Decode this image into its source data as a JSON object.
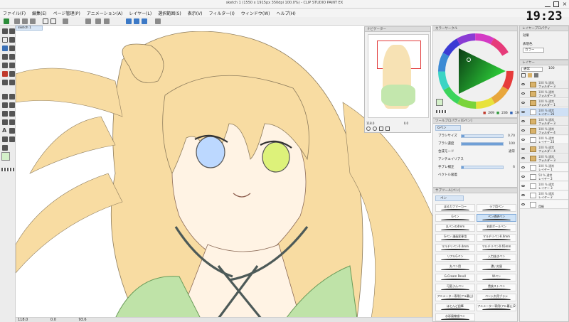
{
  "window": {
    "title": "sketch 1 (1550 x 1915px 350dpi 100.0%) - CLIP STUDIO PAINT EX"
  },
  "menu": {
    "items": [
      "ファイル(F)",
      "編集(E)",
      "ページ管理(P)",
      "アニメーション(A)",
      "レイヤー(L)",
      "選択範囲(S)",
      "表示(V)",
      "フィルター(I)",
      "ウィンドウ(W)",
      "ヘルプ(H)"
    ]
  },
  "clock": "19:23",
  "canvas": {
    "tab_label": "sketch 1"
  },
  "status": {
    "zoom": "118.0",
    "angle": "0.0",
    "label": "93.6"
  },
  "navigator": {
    "title": "ナビゲーター",
    "zoom": "118.0",
    "angle": "0.0"
  },
  "color_wheel": {
    "title": "カラーサークル",
    "h": "269",
    "s": "236",
    "v": "190",
    "colors": {
      "main": "#d4f0c9",
      "sub": "#ffffff"
    }
  },
  "tool_property": {
    "title": "ツールプロパティ[Gペン]",
    "tool_name": "Gペン",
    "rows": [
      {
        "label": "ブラシサイズ",
        "value": "0.70",
        "level": 0.07
      },
      {
        "label": "ブラシ濃度",
        "value": "100",
        "level": 1.0
      },
      {
        "label": "合成モード",
        "value": "通常"
      },
      {
        "label": "アンチエイリアス",
        "value": ""
      },
      {
        "label": "手ブレ補正",
        "value": "6",
        "level": 0.06
      },
      {
        "label": "ベクトル吸着",
        "value": ""
      }
    ]
  },
  "subtool": {
    "title": "サブツール[ペン]",
    "tab": "ペン",
    "brushes": [
      "ほるカフマーカー",
      "ラフ用ペン",
      "Gペン",
      "ペン透明ペン",
      "丸ペンの4mm",
      "名前ボールペン",
      "Gペン 漫画家専用",
      "マルチリペン8.0mm",
      "マルチリペン0.4mm",
      "マルチリペン0.65mm",
      "リアルGペン",
      "入力抜きペン",
      "丸ペン用",
      "濃い太眉",
      "G-Cream Pencil",
      "Wペン",
      "可変ぶんペン",
      "貴族ストペン",
      "アニメーター専用(アル幕止)",
      "ペン入れ用ブラシ",
      "ほとんど鉛筆",
      "アニメーター専用(アル幕止)2",
      "水彩風線描ペン"
    ],
    "selected_index": 3
  },
  "layer_property": {
    "title": "レイヤープロパティ",
    "effect": "効果",
    "expression": "表現色",
    "expression_value": "カラー"
  },
  "layers": {
    "title": "レイヤー",
    "blend": "通常",
    "opacity": "100",
    "items": [
      {
        "mode": "100 % 通常",
        "name": "フォルダー 3",
        "folder": true
      },
      {
        "mode": "100 % 通常",
        "name": "フォルダー 3",
        "folder": true
      },
      {
        "mode": "100 % 通常",
        "name": "フォルダー 1",
        "folder": true
      },
      {
        "mode": "100 % 通常",
        "name": "レイヤー 26",
        "folder": false,
        "selected": true
      },
      {
        "mode": "100 % 通常",
        "name": "フォルダー 3",
        "folder": true
      },
      {
        "mode": "100 % 通常",
        "name": "フォルダー 4",
        "folder": true
      },
      {
        "mode": "100 % 通常",
        "name": "レイヤー 23",
        "folder": false
      },
      {
        "mode": "100 % 通常",
        "name": "フォルダー 4",
        "folder": true
      },
      {
        "mode": "100 % 通常",
        "name": "フォルダー 3",
        "folder": true
      },
      {
        "mode": "100 % 通常",
        "name": "レイヤー 1",
        "folder": false
      },
      {
        "mode": "50 % 通常",
        "name": "レイヤー 2",
        "folder": false
      },
      {
        "mode": "100 % 通常",
        "name": "レイヤー 3",
        "folder": false
      },
      {
        "mode": "100 % 通常",
        "name": "レイヤー 2",
        "folder": false
      },
      {
        "mode": "",
        "name": "用紙",
        "folder": false
      }
    ]
  },
  "icons": [
    "pen-tool-icon",
    "eraser-icon",
    "fill-icon",
    "text-icon",
    "hand-icon",
    "zoom-icon",
    "eye-icon",
    "folder-icon",
    "new-layer-icon",
    "trash-icon",
    "undo-icon",
    "redo-icon",
    "save-icon"
  ]
}
